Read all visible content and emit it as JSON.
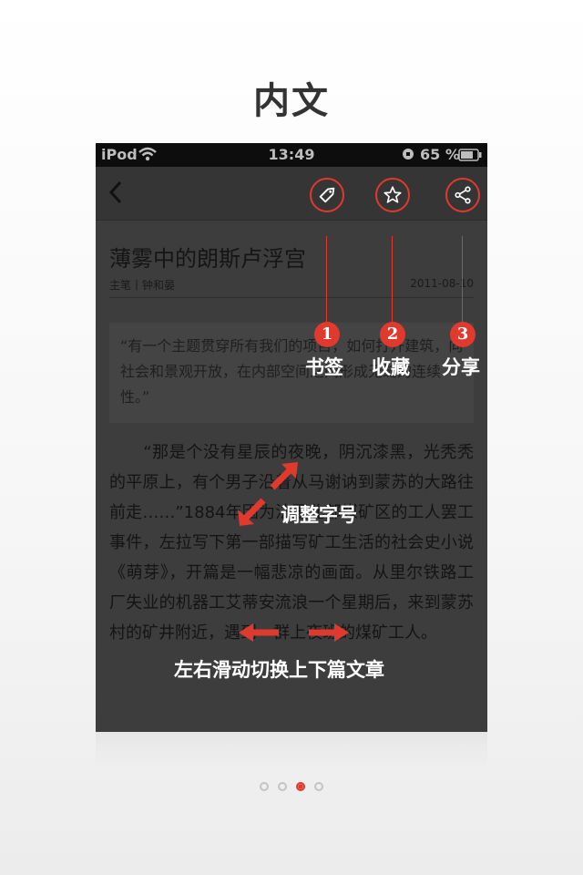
{
  "page_title": "内文",
  "status_bar": {
    "carrier": "iPod",
    "time": "13:49",
    "battery": "65 %"
  },
  "toolbar": {
    "icons": [
      "back-icon",
      "tag-icon",
      "star-icon",
      "share-icon"
    ]
  },
  "article": {
    "title": "薄雾中的朗斯卢浮宫",
    "byline": "主笔丨钟和晏",
    "date": "2011-08-10",
    "quote": "“有一个主题贯穿所有我们的项目，如何打开建筑，向社会和景观开放，在内部空间之间形成无缝的连续性。”",
    "body": "　　“那是个没有星辰的夜晚，阴沉漆黑，光秃秃的平原上，有个男子沿着从马谢讷到蒙苏的大路往前走……”1884年因为法国北部煤矿区的工人罢工事件，左拉写下第一部描写矿工生活的社会史小说《萌芽》，开篇是一幅悲凉的画面。从里尔铁路工厂失业的机器工艾蒂安流浪一个星期后，来到蒙苏村的矿井附近，遇到一群上夜班的煤矿工人。"
  },
  "annotations": {
    "bookmark": {
      "number": "1",
      "label": "书签"
    },
    "favorite": {
      "number": "2",
      "label": "收藏"
    },
    "share": {
      "number": "3",
      "label": "分享"
    },
    "font_size": "调整字号",
    "swipe": "左右滑动切换上下篇文章"
  },
  "pagination": {
    "total": 4,
    "active": 3
  },
  "colors": {
    "accent": "#e0392e",
    "overlay": "#3d3d3d"
  }
}
